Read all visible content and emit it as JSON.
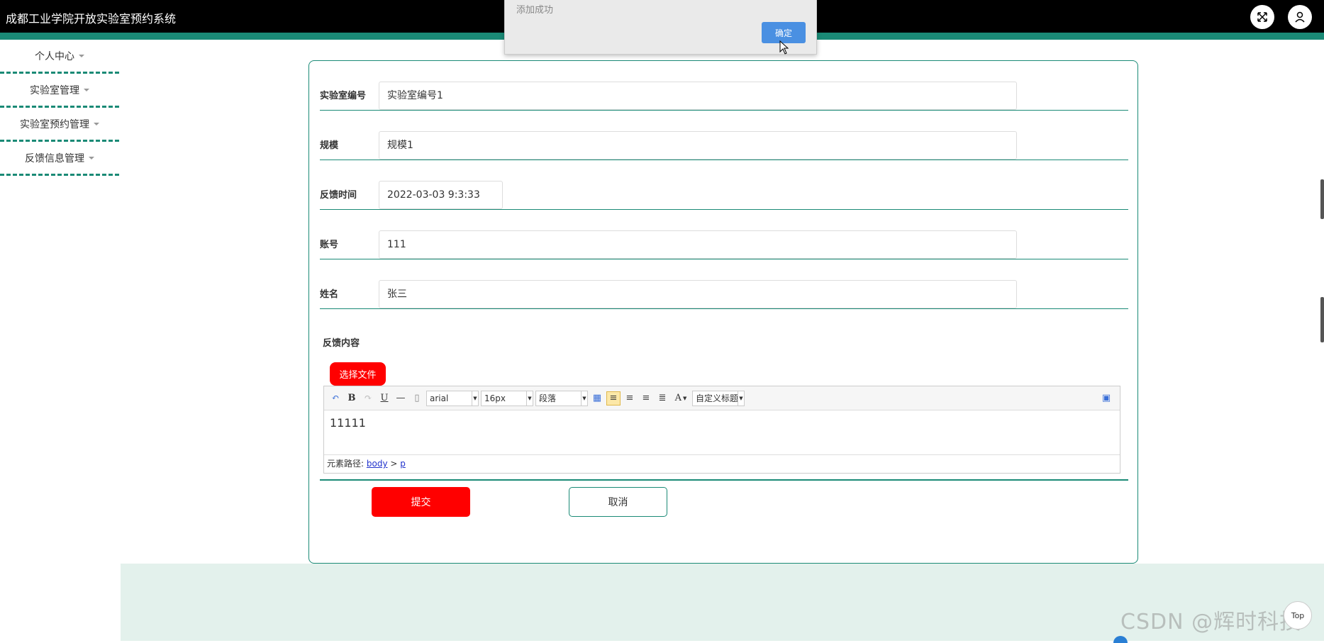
{
  "app": {
    "title": "成都工业学院开放实验室预约系统"
  },
  "header": {
    "fullscreen_icon": "expand-icon",
    "user_icon": "user-icon"
  },
  "sidebar": {
    "items": [
      {
        "label": "个人中心"
      },
      {
        "label": "实验室管理"
      },
      {
        "label": "实验室预约管理"
      },
      {
        "label": "反馈信息管理"
      }
    ]
  },
  "form": {
    "fields": [
      {
        "label": "实验室编号",
        "value": "实验室编号1"
      },
      {
        "label": "规模",
        "value": "规模1"
      },
      {
        "label": "反馈时间",
        "value": "2022-03-03 9:3:33"
      },
      {
        "label": "账号",
        "value": "111"
      },
      {
        "label": "姓名",
        "value": "张三"
      }
    ],
    "content_label": "反馈内容",
    "file_button": "选择文件",
    "editor": {
      "font_family": "arial",
      "font_size": "16px",
      "paragraph": "段落",
      "custom_title": "自定义标题",
      "body_text": "11111",
      "path_label": "元素路径:",
      "path_body": "body",
      "path_sep": ">",
      "path_p": "p"
    },
    "submit_label": "提交",
    "cancel_label": "取消"
  },
  "dialog": {
    "message": "添加成功",
    "ok_label": "确定"
  },
  "top_button": "Top",
  "watermark": "CSDN @辉时科技",
  "colors": {
    "accent": "#1a8a76",
    "danger": "#ff0000",
    "dialog_ok": "#4a90e2",
    "footer_bg": "#e3f1ec"
  }
}
